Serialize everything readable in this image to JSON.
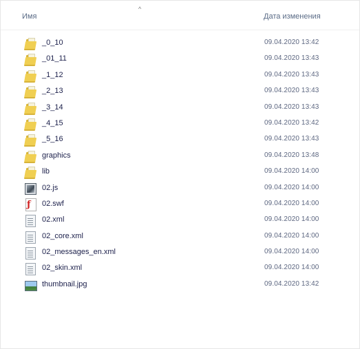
{
  "header": {
    "col_name": "Имя",
    "col_date": "Дата изменения",
    "sort_indicator": "^"
  },
  "files": [
    {
      "name": "_0_10",
      "date": "09.04.2020 13:42",
      "icon": "folder-icon"
    },
    {
      "name": "_01_11",
      "date": "09.04.2020 13:43",
      "icon": "folder-icon"
    },
    {
      "name": "_1_12",
      "date": "09.04.2020 13:43",
      "icon": "folder-icon"
    },
    {
      "name": "_2_13",
      "date": "09.04.2020 13:43",
      "icon": "folder-icon"
    },
    {
      "name": "_3_14",
      "date": "09.04.2020 13:43",
      "icon": "folder-icon"
    },
    {
      "name": "_4_15",
      "date": "09.04.2020 13:42",
      "icon": "folder-icon"
    },
    {
      "name": "_5_16",
      "date": "09.04.2020 13:43",
      "icon": "folder-icon"
    },
    {
      "name": "graphics",
      "date": "09.04.2020 13:48",
      "icon": "folder-icon"
    },
    {
      "name": "lib",
      "date": "09.04.2020 14:00",
      "icon": "folder-icon"
    },
    {
      "name": "02.js",
      "date": "09.04.2020 14:00",
      "icon": "js-file-icon"
    },
    {
      "name": "02.swf",
      "date": "09.04.2020 14:00",
      "icon": "swf-file-icon"
    },
    {
      "name": "02.xml",
      "date": "09.04.2020 14:00",
      "icon": "xml-file-icon"
    },
    {
      "name": "02_core.xml",
      "date": "09.04.2020 14:00",
      "icon": "xml-file-icon"
    },
    {
      "name": "02_messages_en.xml",
      "date": "09.04.2020 14:00",
      "icon": "xml-file-icon"
    },
    {
      "name": "02_skin.xml",
      "date": "09.04.2020 14:00",
      "icon": "xml-file-icon"
    },
    {
      "name": "thumbnail.jpg",
      "date": "09.04.2020 13:42",
      "icon": "image-file-icon"
    }
  ]
}
